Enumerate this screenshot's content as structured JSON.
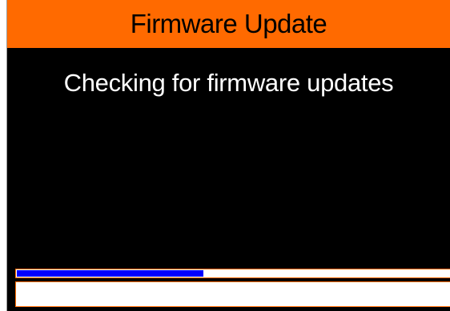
{
  "window": {
    "title": "Firmware Update"
  },
  "main": {
    "status_message": "Checking for firmware updates"
  },
  "progress": {
    "fraction": 0.43,
    "fill_color": "#0000ff"
  },
  "message_box": {
    "text": ""
  },
  "colors": {
    "title_bar": "#ff6a00",
    "background": "#000000",
    "text": "#ffffff"
  }
}
